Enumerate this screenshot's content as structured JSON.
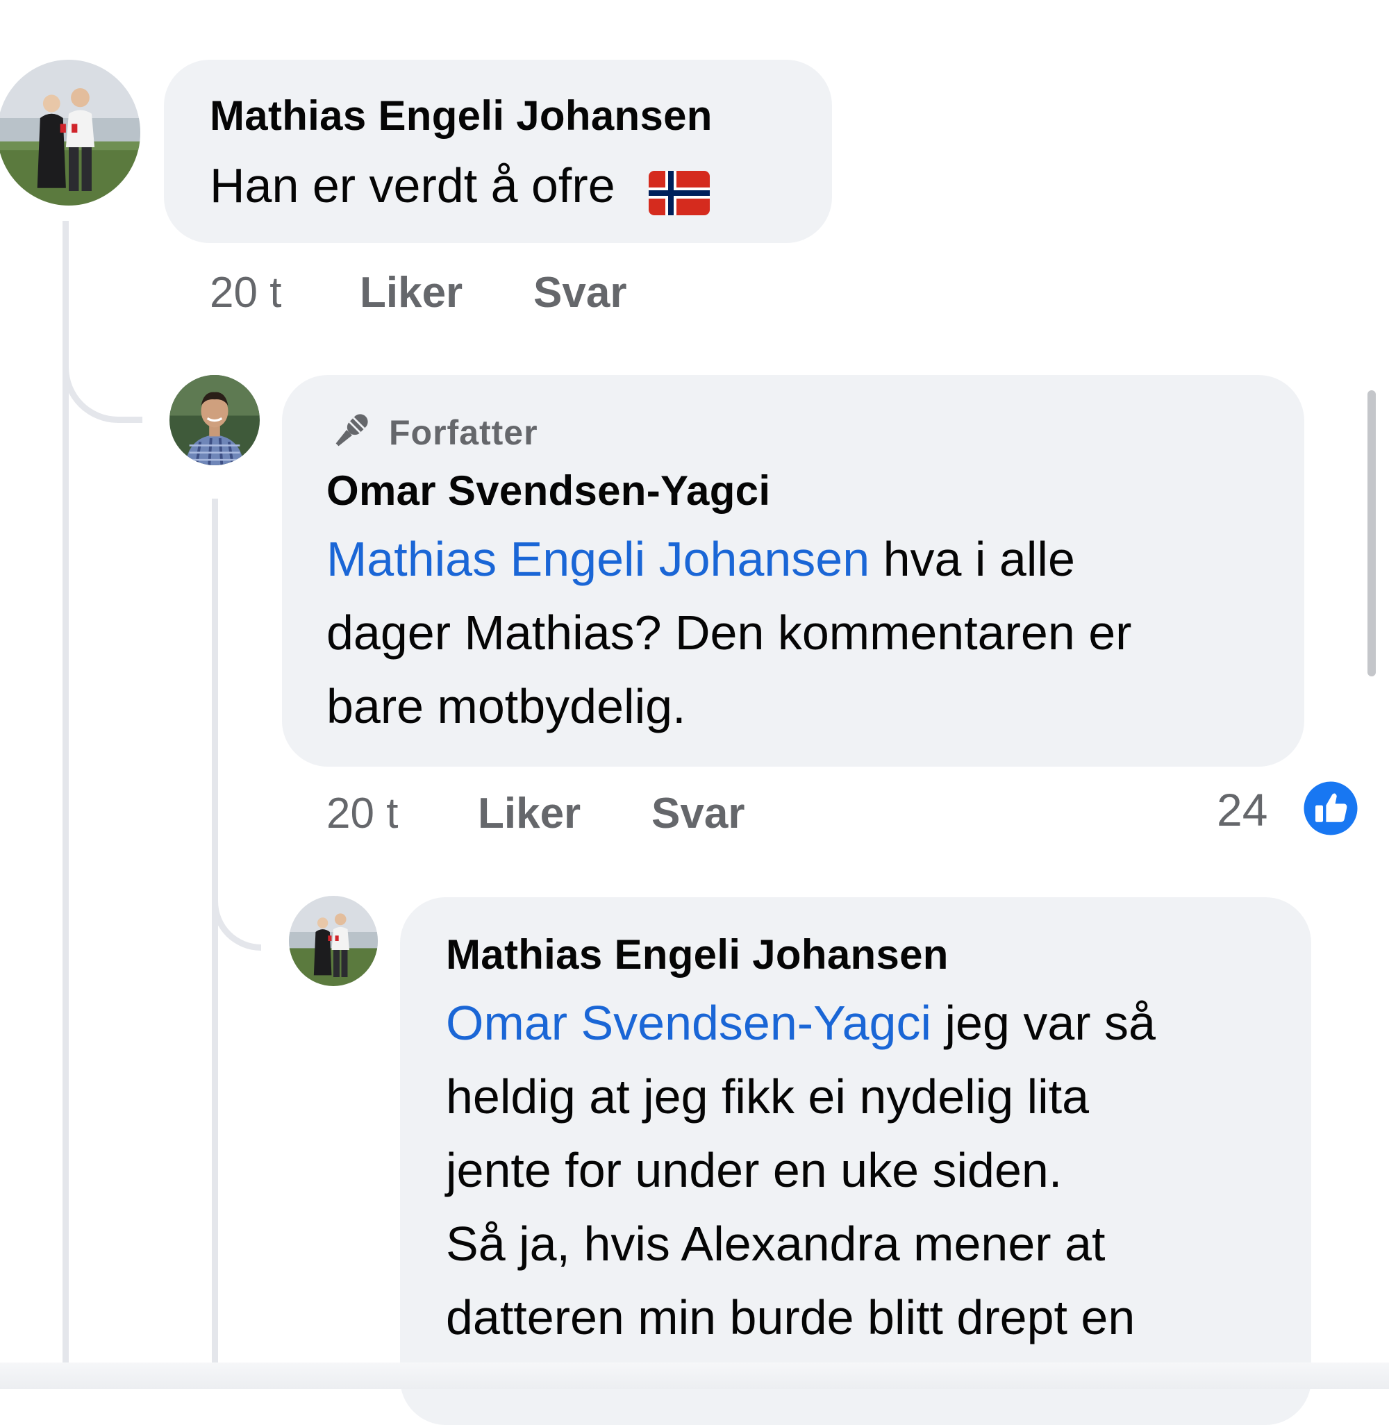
{
  "colors": {
    "bubble": "#f0f2f5",
    "mention": "#1a66d6",
    "meta": "#65676b",
    "like_blue": "#1877f2",
    "thread_line": "#e4e6eb"
  },
  "comments": [
    {
      "author": "Mathias Engeli Johansen",
      "text": "Han er verdt å ofre",
      "emoji": "norway-flag-emoji",
      "time": "20 t",
      "like_label": "Liker",
      "reply_label": "Svar",
      "avatar": "couple-photo-avatar"
    },
    {
      "badge": "Forfatter",
      "badge_icon": "microphone-icon",
      "author": "Omar Svendsen-Yagci",
      "mention": "Mathias Engeli Johansen",
      "text_line1": " hva i alle",
      "text_line2": "dager Mathias? Den kommentaren er",
      "text_line3": "bare motbydelig.",
      "time": "20 t",
      "like_label": "Liker",
      "reply_label": "Svar",
      "reaction_count": "24",
      "reaction_icon": "thumbs-up-icon",
      "avatar": "man-portrait-avatar"
    },
    {
      "author": "Mathias Engeli Johansen",
      "mention": "Omar Svendsen-Yagci",
      "text_line1": " jeg var så",
      "text_line2": "heldig at jeg fikk ei nydelig lita",
      "text_line3": "jente for under en uke siden.",
      "text_line4": "Så ja, hvis Alexandra mener at",
      "text_line5": "datteren min burde blitt drept en",
      "avatar": "couple-photo-avatar"
    }
  ]
}
